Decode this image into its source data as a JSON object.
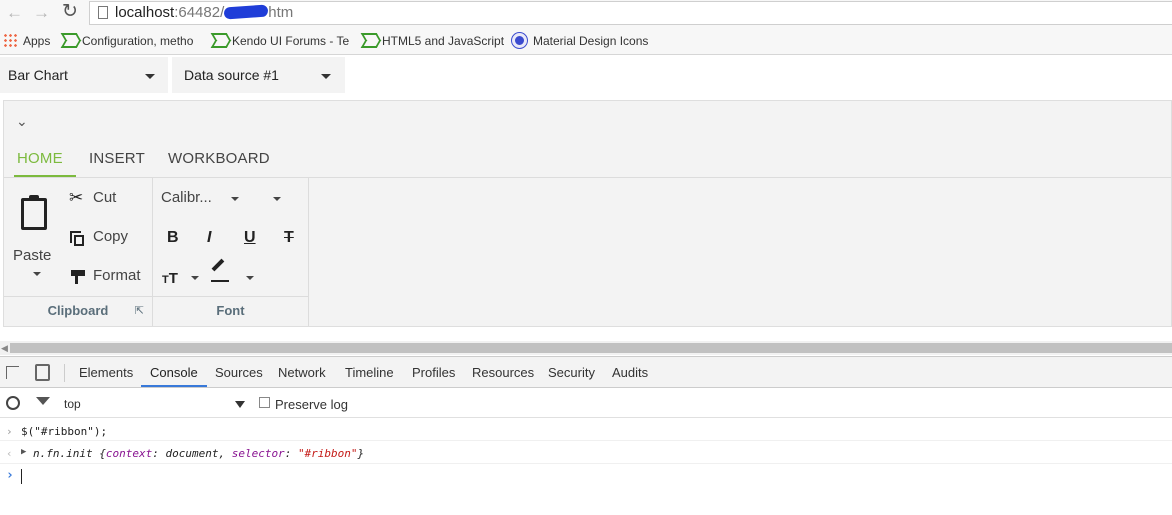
{
  "browser": {
    "url_host": "localhost",
    "url_port": ":64482/",
    "url_suffix": "htm",
    "bookmarks": [
      {
        "label": "Apps",
        "icon": "apps-icon"
      },
      {
        "label": "Configuration, metho",
        "icon": "kendo-icon"
      },
      {
        "label": "Kendo UI Forums - Te",
        "icon": "kendo-icon"
      },
      {
        "label": "HTML5 and JavaScript",
        "icon": "kendo-icon"
      },
      {
        "label": "Material Design Icons",
        "icon": "material-design-icon"
      }
    ]
  },
  "toolbar": {
    "chart_type": "Bar Chart",
    "data_source": "Data source #1"
  },
  "ribbon": {
    "tabs": [
      "HOME",
      "INSERT",
      "WORKBOARD"
    ],
    "active_tab": "HOME",
    "clipboard": {
      "paste": "Paste",
      "cut": "Cut",
      "copy": "Copy",
      "format": "Format",
      "group_label": "Clipboard"
    },
    "font": {
      "font_name": "Calibr...",
      "bold": "B",
      "italic": "I",
      "underline": "U",
      "strike": "T",
      "size_glyph": "T",
      "group_label": "Font"
    }
  },
  "devtools": {
    "tabs": [
      "Elements",
      "Console",
      "Sources",
      "Network",
      "Timeline",
      "Profiles",
      "Resources",
      "Security",
      "Audits"
    ],
    "active_tab": "Console",
    "context": "top",
    "preserve_log": "Preserve log",
    "lines": {
      "input": "$(\"#ribbon\");",
      "out_prefix": "n.fn.init ",
      "out_open": "{",
      "out_k1": "context",
      "out_v1": "document",
      "out_k2": "selector",
      "out_v2": "\"#ribbon\"",
      "out_close": "}"
    }
  }
}
